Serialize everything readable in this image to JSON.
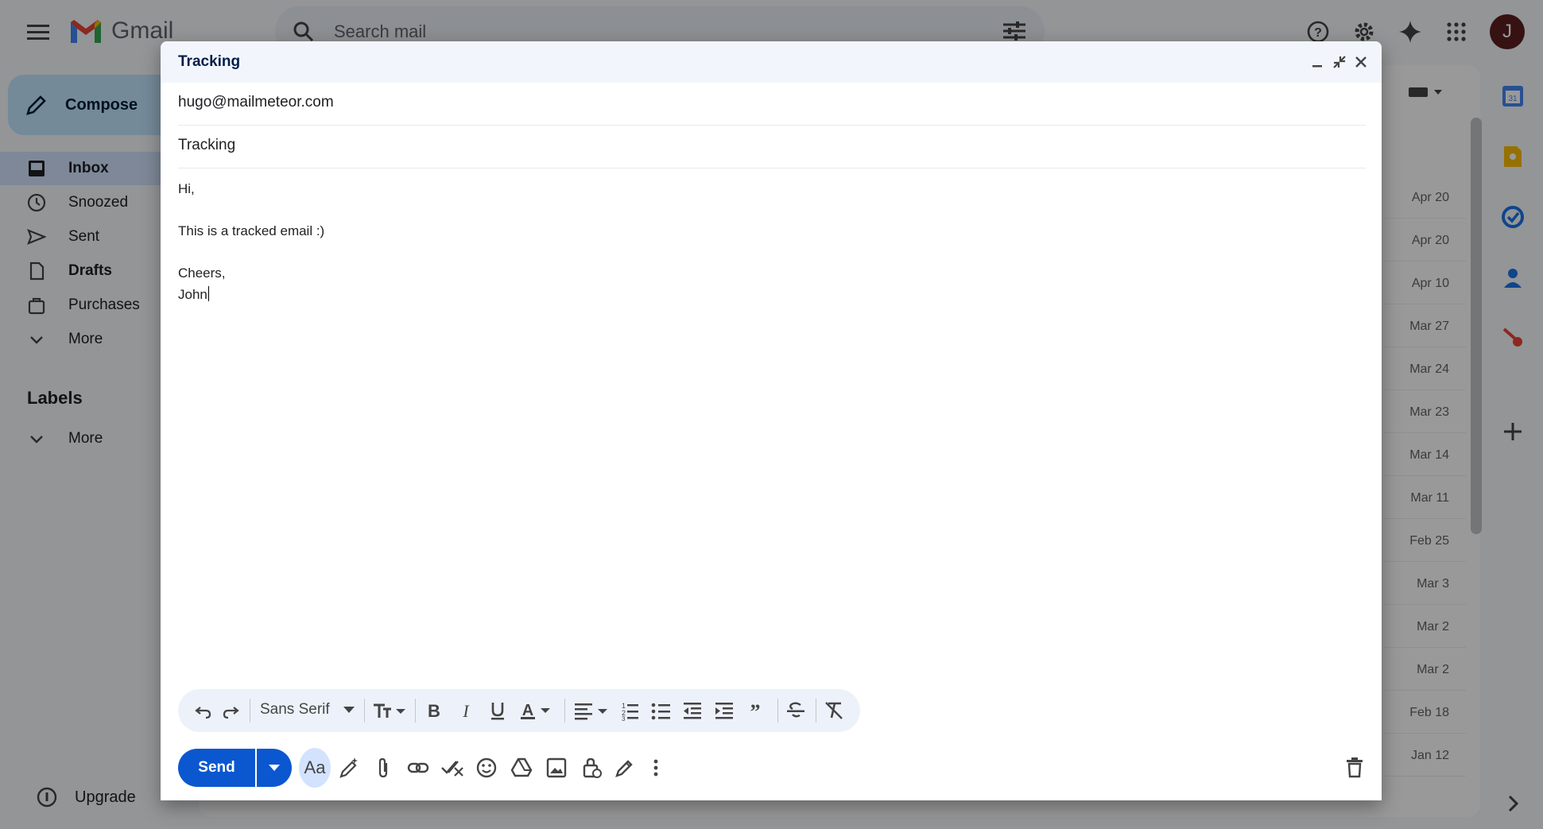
{
  "app": {
    "name": "Gmail",
    "avatar_letter": "J"
  },
  "search": {
    "placeholder": "Search mail"
  },
  "nav": {
    "compose_label": "Compose",
    "items": [
      {
        "label": "Inbox"
      },
      {
        "label": "Snoozed"
      },
      {
        "label": "Sent"
      },
      {
        "label": "Drafts"
      },
      {
        "label": "Purchases"
      },
      {
        "label": "More"
      }
    ],
    "labels_title": "Labels",
    "labels_more": "More",
    "upgrade_label": "Upgrade"
  },
  "list": {
    "dates": [
      "Apr 20",
      "Apr 20",
      "Apr 10",
      "Mar 27",
      "Mar 24",
      "Mar 23",
      "Mar 14",
      "Mar 11",
      "Feb 25",
      "Mar 3",
      "Mar 2",
      "Mar 2",
      "Feb 18",
      "Jan 12"
    ]
  },
  "compose": {
    "title": "Tracking",
    "to": "hugo@mailmeteor.com",
    "subject": "Tracking",
    "body_lines": [
      "Hi,",
      "This is a tracked email :)",
      "Cheers,",
      "John"
    ],
    "font_name": "Sans Serif",
    "send_label": "Send"
  },
  "colors": {
    "primary_blue": "#0b57d0",
    "compose_bg": "#c2e7ff",
    "active_nav": "#d3e3fd",
    "gmail_red": "#ea4335",
    "avatar_bg": "#5a1f1f"
  }
}
